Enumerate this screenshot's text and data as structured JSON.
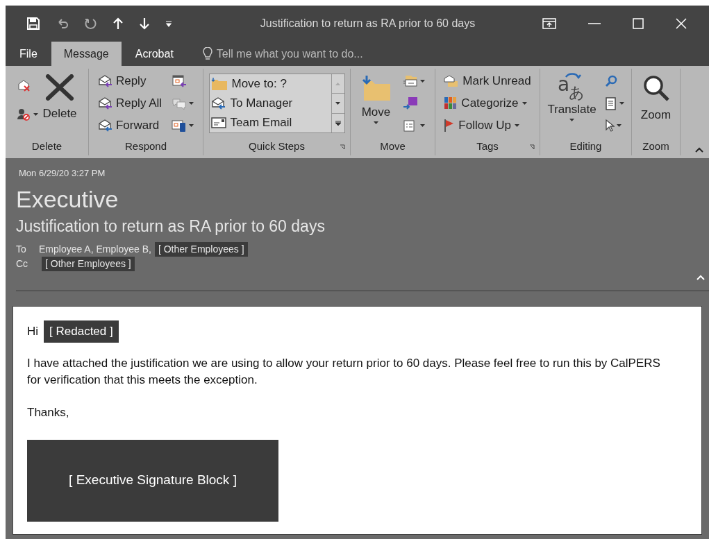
{
  "window": {
    "title": "Justification to return as RA prior to 60 days"
  },
  "tabs": [
    {
      "label": "File",
      "selected": false
    },
    {
      "label": "Message",
      "selected": true
    },
    {
      "label": "Acrobat",
      "selected": false
    }
  ],
  "tell_me": {
    "placeholder": "Tell me what you want to do..."
  },
  "ribbon": {
    "groups": [
      {
        "label": "Delete",
        "buttons": [
          {
            "label": "Delete",
            "dropdown": false
          }
        ]
      },
      {
        "label": "Respond",
        "buttons": [
          {
            "label": "Reply",
            "dropdown": false
          },
          {
            "label": "Reply All",
            "dropdown": false
          },
          {
            "label": "Forward",
            "dropdown": false
          }
        ]
      },
      {
        "label": "Quick Steps",
        "buttons": [
          {
            "label": "Move to: ?",
            "dropdown": false
          },
          {
            "label": "To Manager",
            "dropdown": false
          },
          {
            "label": "Team Email",
            "dropdown": false
          }
        ]
      },
      {
        "label": "Move",
        "buttons": [
          {
            "label": "Move",
            "dropdown": true
          }
        ]
      },
      {
        "label": "Tags",
        "buttons": [
          {
            "label": "Mark Unread",
            "dropdown": false
          },
          {
            "label": "Categorize",
            "dropdown": true
          },
          {
            "label": "Follow Up",
            "dropdown": true
          }
        ]
      },
      {
        "label": "Editing",
        "buttons": [
          {
            "label": "Translate",
            "dropdown": true,
            "icon_glyphs": [
              "a",
              "あ"
            ]
          }
        ]
      },
      {
        "label": "Zoom",
        "buttons": [
          {
            "label": "Zoom",
            "dropdown": false
          }
        ]
      }
    ]
  },
  "header": {
    "date": "Mon 6/29/20 3:27 PM",
    "sender": "Executive",
    "subject": "Justification to return as RA prior to 60 days",
    "to_label": "To",
    "to": "Employee A, Employee B,",
    "to_redacted": "[ Other Employees ]",
    "cc_label": "Cc",
    "cc_redacted": "[ Other Employees ]"
  },
  "body": {
    "greeting": "Hi",
    "greeting_redacted": "[ Redacted ]",
    "paragraph": "I have attached the justification we are using to allow your return prior to 60 days. Please feel free to run this by CalPERS for verification that this meets the exception.",
    "closing": "Thanks,",
    "signature": "[ Executive Signature Block ]"
  }
}
